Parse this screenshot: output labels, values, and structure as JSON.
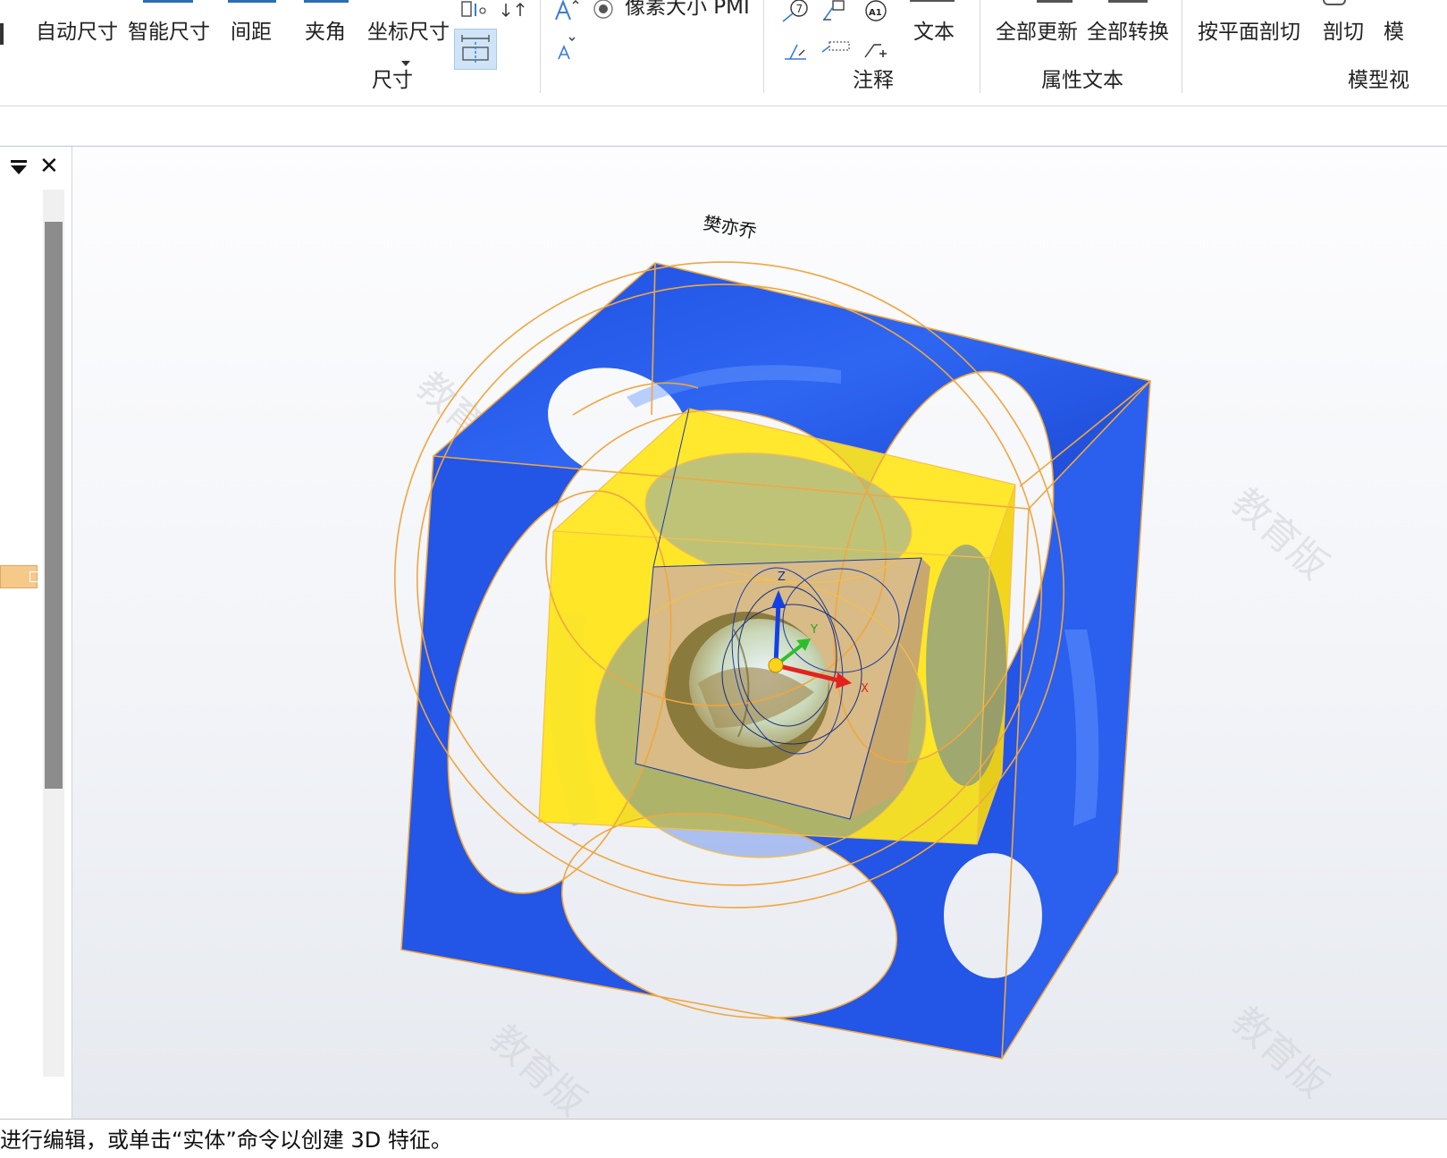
{
  "ribbon": {
    "buttons": {
      "auto_dim": "自动尺寸",
      "smart_dim": "智能尺寸",
      "spacing": "间距",
      "angle": "夹角",
      "coord_dim": "坐标尺寸",
      "pixel_pmi": "像素大小 PMI",
      "text": "文本",
      "update_all": "全部更新",
      "convert_all": "全部转换",
      "section_by_plane": "按平面剖切",
      "section": "剖切",
      "model_partial": "模"
    },
    "groups": {
      "dimension": "尺寸",
      "annotation": "注释",
      "property_text": "属性文本",
      "model_view": "模型视"
    }
  },
  "viewport": {
    "model_label": "樊亦乔",
    "watermark": "教育版",
    "axes": {
      "x": "X",
      "y": "Y",
      "z": "Z"
    }
  },
  "status": {
    "text": "进行编辑，或单击“实体”命令以创建 3D 特征。"
  },
  "colors": {
    "frame_blue": "#2458e8",
    "cube_yellow": "#ffe51a",
    "core_tan": "#d9bb86",
    "edge_orange": "#f0a640"
  }
}
